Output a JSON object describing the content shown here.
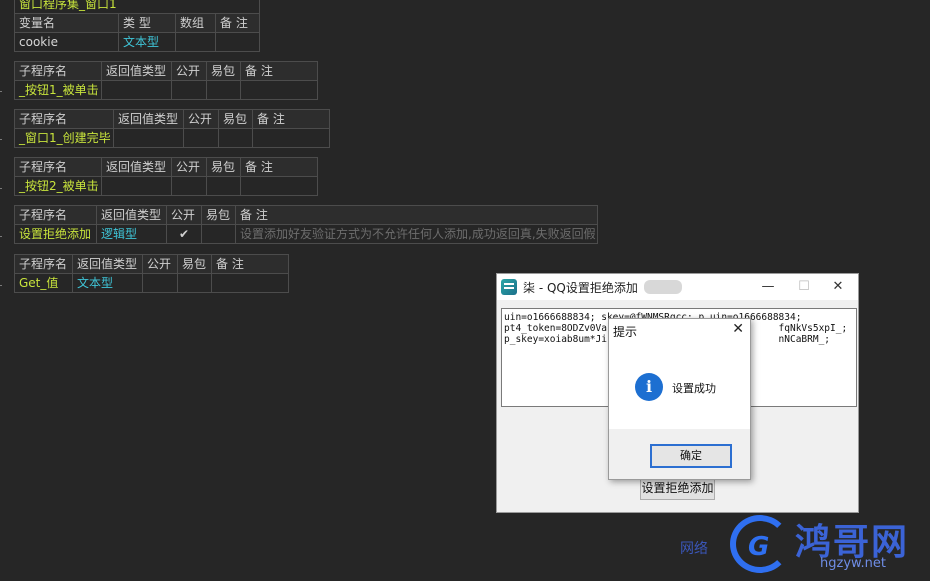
{
  "window1_table": {
    "header_cut": "窗口程序集_窗口1",
    "headers": [
      "变量名",
      "类 型",
      "数组",
      "备 注"
    ],
    "row": [
      "cookie",
      "文本型",
      "",
      ""
    ]
  },
  "sub1": {
    "headers": [
      "子程序名",
      "返回值类型",
      "公开",
      "易包",
      "备 注"
    ],
    "row": [
      "_按钮1_被单击",
      "",
      "",
      "",
      ""
    ]
  },
  "sub2": {
    "headers": [
      "子程序名",
      "返回值类型",
      "公开",
      "易包",
      "备 注"
    ],
    "row": [
      "_窗口1_创建完毕",
      "",
      "",
      "",
      ""
    ]
  },
  "sub3": {
    "headers": [
      "子程序名",
      "返回值类型",
      "公开",
      "易包",
      "备 注"
    ],
    "row": [
      "_按钮2_被单击",
      "",
      "",
      "",
      ""
    ]
  },
  "sub4": {
    "headers": [
      "子程序名",
      "返回值类型",
      "公开",
      "易包",
      "备 注"
    ],
    "row": [
      "设置拒绝添加",
      "逻辑型",
      "✔",
      "",
      "设置添加好友验证方式为不允许任何人添加,成功返回真,失败返回假"
    ]
  },
  "sub5": {
    "headers": [
      "子程序名",
      "返回值类型",
      "公开",
      "易包",
      "备 注"
    ],
    "row": [
      "Get_值",
      "文本型",
      "",
      "",
      ""
    ]
  },
  "main_window": {
    "title": "柒 - QQ设置拒绝添加",
    "minimize": "—",
    "maximize": "☐",
    "close": "✕",
    "textarea": "uin=o1666688834; skey=@fWNMSRqcc; p_uin=o1666688834;\npt4_token=8ODZv0Va                              fqNkVs5xpI_;\np_skey=xoiab8um*Ji                              nNCaBRM_;",
    "button": "设置拒绝添加"
  },
  "dialog": {
    "title": "提示",
    "close": "✕",
    "icon": "i",
    "message": "设置成功",
    "ok": "确定"
  },
  "watermark": {
    "name": "鸿哥网",
    "url": "hgzyw.net",
    "left": "网络",
    "g": "G"
  }
}
